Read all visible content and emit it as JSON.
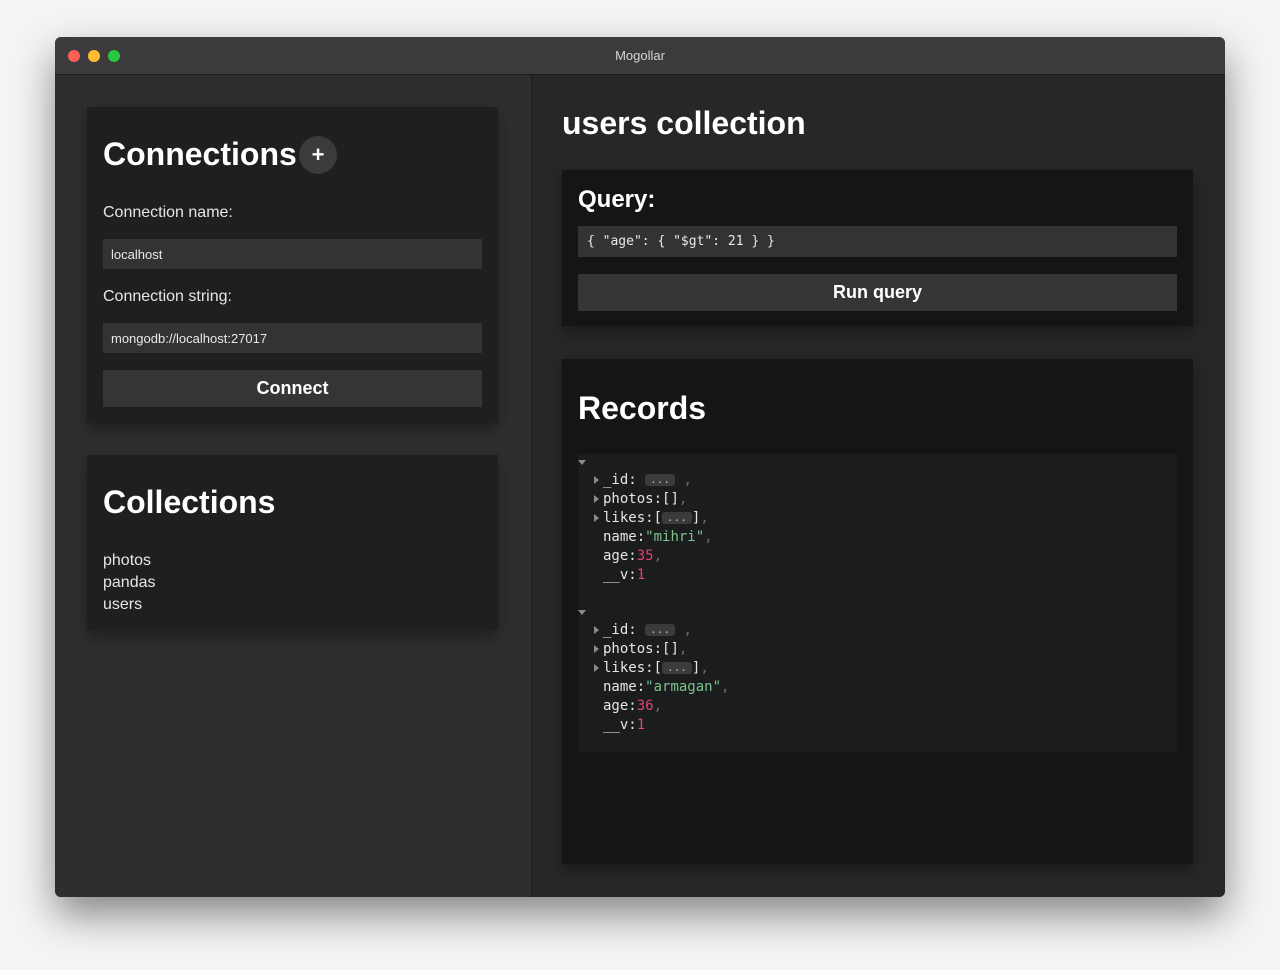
{
  "window": {
    "title": "Mogollar"
  },
  "connections": {
    "heading": "Connections",
    "add_label": "+",
    "name_label": "Connection name:",
    "name_value": "localhost",
    "string_label": "Connection string:",
    "string_value": "mongodb://localhost:27017",
    "connect_label": "Connect"
  },
  "collections": {
    "heading": "Collections",
    "items": [
      {
        "label": "photos"
      },
      {
        "label": "pandas"
      },
      {
        "label": "users"
      }
    ]
  },
  "main": {
    "title": "users collection",
    "query": {
      "heading": "Query:",
      "value": "{ \"age\": { \"$gt\": 21 } }",
      "run_label": "Run query"
    },
    "records": {
      "heading": "Records",
      "items": [
        {
          "id_key": "_id:",
          "photos_key": "photos:",
          "photos_val": "[]",
          "likes_key": "likes:",
          "name_key": "name:",
          "name_val": "\"mihri\"",
          "age_key": "age:",
          "age_val": "35",
          "v_key": "__v:",
          "v_val": "1",
          "ellipsis": "..."
        },
        {
          "id_key": "_id:",
          "photos_key": "photos:",
          "photos_val": "[]",
          "likes_key": "likes:",
          "name_key": "name:",
          "name_val": "\"armagan\"",
          "age_key": "age:",
          "age_val": "36",
          "v_key": "__v:",
          "v_val": "1",
          "ellipsis": "..."
        }
      ]
    }
  }
}
